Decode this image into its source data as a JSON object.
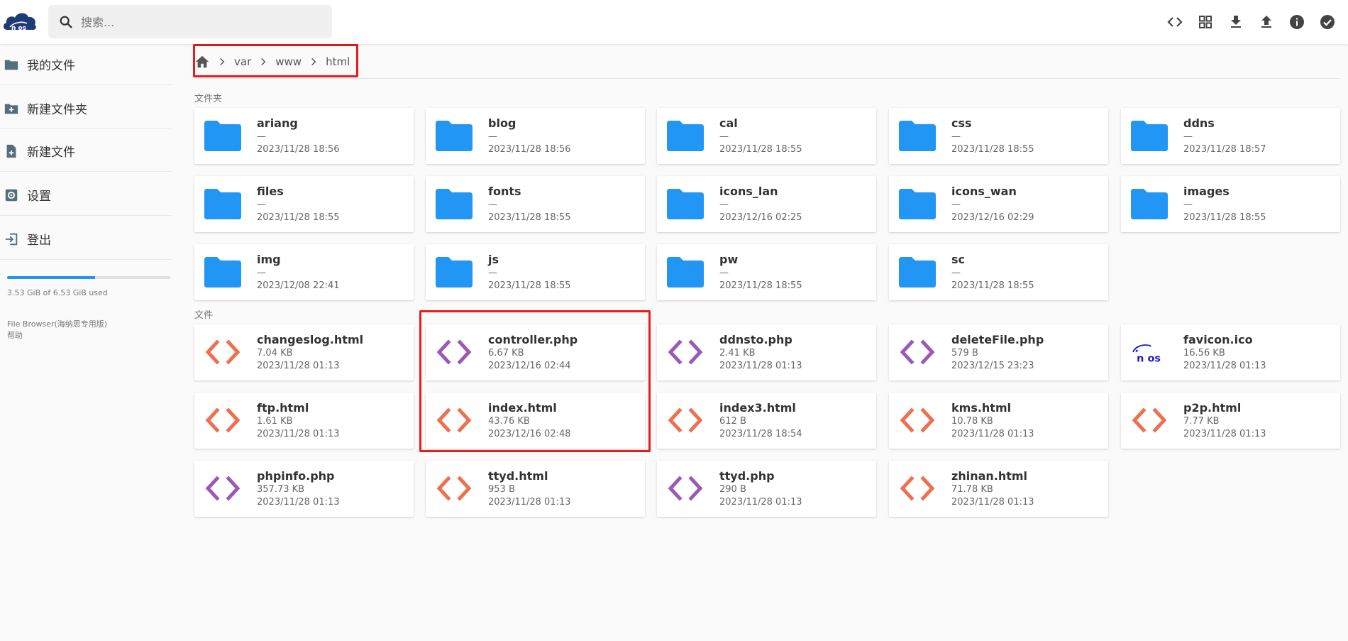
{
  "header": {
    "logo_text": "n os",
    "search_placeholder": "搜索...",
    "actions": [
      "code-icon",
      "grid-view-icon",
      "download-icon",
      "upload-icon",
      "info-icon",
      "check-circle-icon"
    ]
  },
  "sidebar": {
    "items": [
      {
        "label": "我的文件",
        "icon": "folder-icon"
      },
      {
        "label": "新建文件夹",
        "icon": "new-folder-icon"
      },
      {
        "label": "新建文件",
        "icon": "new-file-icon"
      },
      {
        "label": "设置",
        "icon": "settings-icon"
      },
      {
        "label": "登出",
        "icon": "logout-icon"
      }
    ],
    "usage_fraction": 0.54,
    "usage_text": "3.53 GiB of 6.53 GiB used",
    "app_name": "File Browser(海纳思专用版)",
    "help_label": "帮助"
  },
  "breadcrumb": [
    "var",
    "www",
    "html"
  ],
  "colors": {
    "folder": "#2196f3",
    "html_icon": "#ed7050",
    "php_icon": "#9b59b6",
    "highlight": "#e81c1c",
    "accent": "#2196f3"
  },
  "folders_label": "文件夹",
  "files_label": "文件",
  "folders": [
    {
      "name": "ariang",
      "size": "—",
      "date": "2023/11/28 18:56"
    },
    {
      "name": "blog",
      "size": "—",
      "date": "2023/11/28 18:56"
    },
    {
      "name": "cal",
      "size": "—",
      "date": "2023/11/28 18:55"
    },
    {
      "name": "css",
      "size": "—",
      "date": "2023/11/28 18:55"
    },
    {
      "name": "ddns",
      "size": "—",
      "date": "2023/11/28 18:57"
    },
    {
      "name": "files",
      "size": "—",
      "date": "2023/11/28 18:55"
    },
    {
      "name": "fonts",
      "size": "—",
      "date": "2023/11/28 18:55"
    },
    {
      "name": "icons_lan",
      "size": "—",
      "date": "2023/12/16 02:25"
    },
    {
      "name": "icons_wan",
      "size": "—",
      "date": "2023/12/16 02:29"
    },
    {
      "name": "images",
      "size": "—",
      "date": "2023/11/28 18:55"
    },
    {
      "name": "img",
      "size": "—",
      "date": "2023/12/08 22:41"
    },
    {
      "name": "js",
      "size": "—",
      "date": "2023/11/28 18:55"
    },
    {
      "name": "pw",
      "size": "—",
      "date": "2023/11/28 18:55"
    },
    {
      "name": "sc",
      "size": "—",
      "date": "2023/11/28 18:55"
    }
  ],
  "files": [
    {
      "name": "changeslog.html",
      "size": "7.04 KB",
      "date": "2023/11/28 01:13",
      "kind": "html"
    },
    {
      "name": "controller.php",
      "size": "6.67 KB",
      "date": "2023/12/16 02:44",
      "kind": "php"
    },
    {
      "name": "ddnsto.php",
      "size": "2.41 KB",
      "date": "2023/11/28 01:13",
      "kind": "php"
    },
    {
      "name": "deleteFile.php",
      "size": "579 B",
      "date": "2023/12/15 23:23",
      "kind": "php"
    },
    {
      "name": "favicon.ico",
      "size": "16.56 KB",
      "date": "2023/11/28 01:13",
      "kind": "ico"
    },
    {
      "name": "ftp.html",
      "size": "1.61 KB",
      "date": "2023/11/28 01:13",
      "kind": "html"
    },
    {
      "name": "index.html",
      "size": "43.76 KB",
      "date": "2023/12/16 02:48",
      "kind": "html"
    },
    {
      "name": "index3.html",
      "size": "612 B",
      "date": "2023/11/28 18:54",
      "kind": "html"
    },
    {
      "name": "kms.html",
      "size": "10.78 KB",
      "date": "2023/11/28 01:13",
      "kind": "html"
    },
    {
      "name": "p2p.html",
      "size": "7.77 KB",
      "date": "2023/11/28 01:13",
      "kind": "html"
    },
    {
      "name": "phpinfo.php",
      "size": "357.73 KB",
      "date": "2023/11/28 01:13",
      "kind": "php"
    },
    {
      "name": "ttyd.html",
      "size": "953 B",
      "date": "2023/11/28 01:13",
      "kind": "html"
    },
    {
      "name": "ttyd.php",
      "size": "290 B",
      "date": "2023/11/28 01:13",
      "kind": "php"
    },
    {
      "name": "zhinan.html",
      "size": "71.78 KB",
      "date": "2023/11/28 01:13",
      "kind": "html"
    }
  ]
}
